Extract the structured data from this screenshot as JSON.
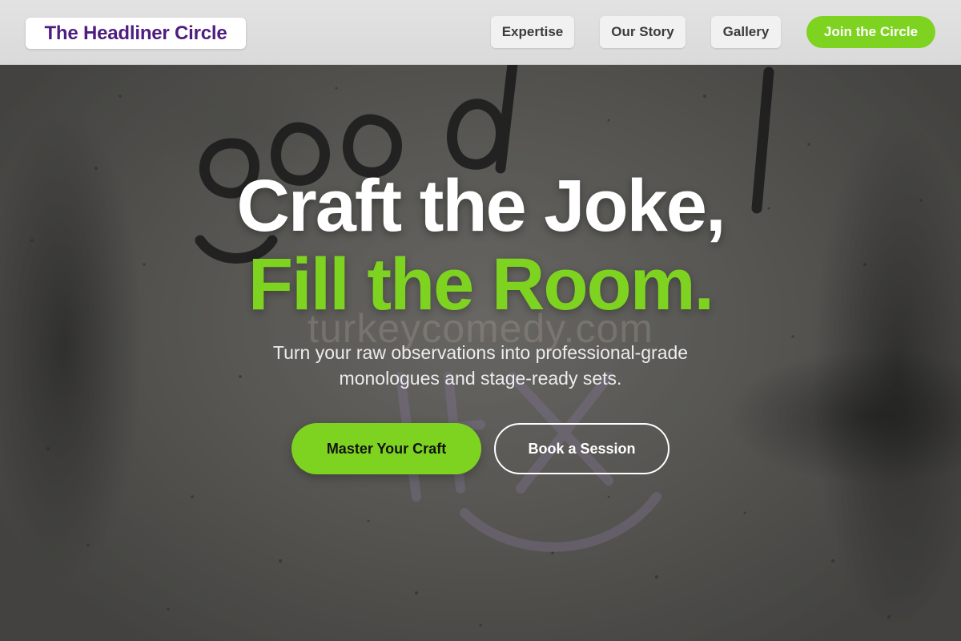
{
  "header": {
    "brand": "The Headliner Circle",
    "nav": [
      {
        "label": "Expertise"
      },
      {
        "label": "Our Story"
      },
      {
        "label": "Gallery"
      }
    ],
    "cta_label": "Join the Circle"
  },
  "hero": {
    "headline_line1": "Craft the Joke,",
    "headline_line2": "Fill the Room.",
    "watermark": "turkeycomedy.com",
    "subtitle": "Turn your raw observations into professional-grade monologues and stage-ready sets.",
    "primary_cta": "Master Your Craft",
    "secondary_cta": "Book a Session"
  },
  "colors": {
    "accent_green": "#7ed320",
    "brand_purple": "#4e1d7f",
    "header_bg": "#dedede",
    "nav_button_bg": "#f1f1f1"
  }
}
